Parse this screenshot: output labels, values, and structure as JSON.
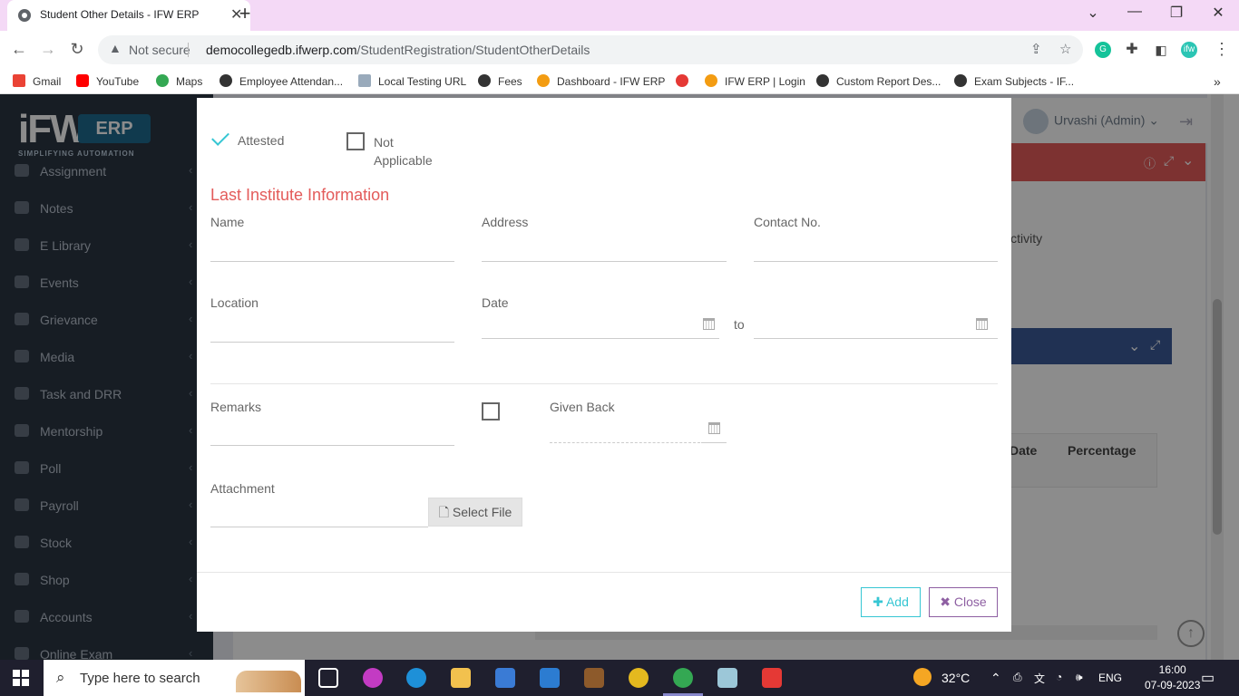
{
  "browser": {
    "tab_title": "Student Other Details - IFW ERP",
    "security_label": "Not secure",
    "url_host": "democollegedb.ifwerp.com",
    "url_path": "/StudentRegistration/StudentOtherDetails",
    "bookmarks": [
      "Gmail",
      "YouTube",
      "Maps",
      "Employee Attendan...",
      "Local Testing URL",
      "Fees",
      "Dashboard - IFW ERP",
      "IFW ERP | Login",
      "Custom Report Des...",
      "Exam Subjects - IF..."
    ]
  },
  "app": {
    "logo_text": "iFW",
    "logo_badge": "ERP",
    "tagline": "SIMPLIFYING AUTOMATION",
    "user_label": "Urvashi (Admin)",
    "menu": [
      "Assignment",
      "Notes",
      "E Library",
      "Events",
      "Grievance",
      "Media",
      "Task and DRR",
      "Mentorship",
      "Poll",
      "Payroll",
      "Stock",
      "Shop",
      "Accounts",
      "Online Exam"
    ],
    "bg_activity": "r Activity",
    "bg_col_date": "Date",
    "bg_col_percentage": "Percentage"
  },
  "modal": {
    "attested_label": "Attested",
    "not_applicable_label": "Not Applicable",
    "attested_checked": true,
    "not_applicable_checked": false,
    "section_title": "Last Institute Information",
    "fields": {
      "name_label": "Name",
      "address_label": "Address",
      "contact_label": "Contact No.",
      "location_label": "Location",
      "date_label": "Date",
      "date_to": "to",
      "remarks_label": "Remarks",
      "given_back_label": "Given Back",
      "given_back_checked": false,
      "attachment_label": "Attachment",
      "select_file": "Select File"
    },
    "add_button": "Add",
    "close_button": "Close"
  },
  "taskbar": {
    "search_placeholder": "Type here to search",
    "weather": "32°C",
    "language": "ENG",
    "time": "16:00",
    "date": "07-09-2023"
  }
}
